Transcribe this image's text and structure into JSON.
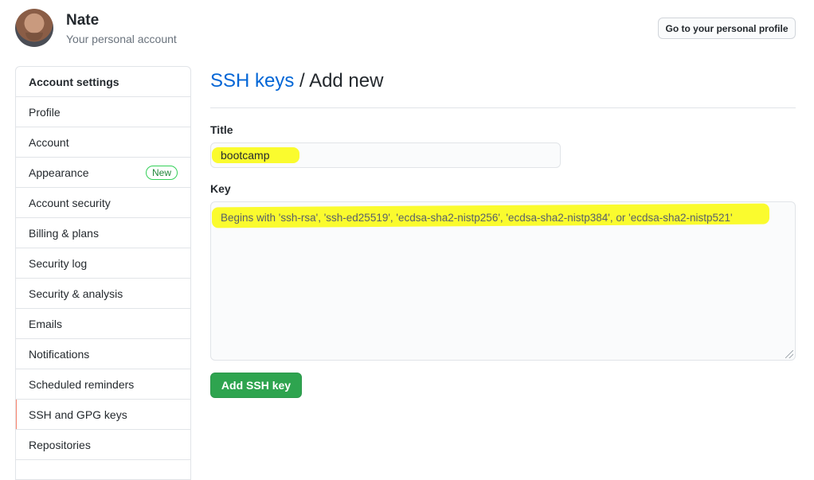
{
  "user": {
    "name": "Nate",
    "subtitle": "Your personal account",
    "profile_button": "Go to your personal profile"
  },
  "sidebar": {
    "header": "Account settings",
    "items": [
      {
        "label": "Profile"
      },
      {
        "label": "Account"
      },
      {
        "label": "Appearance",
        "badge": "New"
      },
      {
        "label": "Account security"
      },
      {
        "label": "Billing & plans"
      },
      {
        "label": "Security log"
      },
      {
        "label": "Security & analysis"
      },
      {
        "label": "Emails"
      },
      {
        "label": "Notifications"
      },
      {
        "label": "Scheduled reminders"
      },
      {
        "label": "SSH and GPG keys",
        "selected": true
      },
      {
        "label": "Repositories"
      }
    ]
  },
  "main": {
    "breadcrumb_link": "SSH keys",
    "breadcrumb_sep": " / ",
    "breadcrumb_current": "Add new",
    "title_label": "Title",
    "title_value": "bootcamp",
    "key_label": "Key",
    "key_placeholder": "Begins with 'ssh-rsa', 'ssh-ed25519', 'ecdsa-sha2-nistp256', 'ecdsa-sha2-nistp384', or 'ecdsa-sha2-nistp521'",
    "submit_button": "Add SSH key"
  },
  "colors": {
    "link": "#0366d6",
    "primary_button": "#2ea44f",
    "selected_marker": "#f9826c",
    "highlight": "#ffff00",
    "badge_green": "#22863a"
  },
  "icons": [
    "avatar",
    "resize-grip-icon"
  ]
}
